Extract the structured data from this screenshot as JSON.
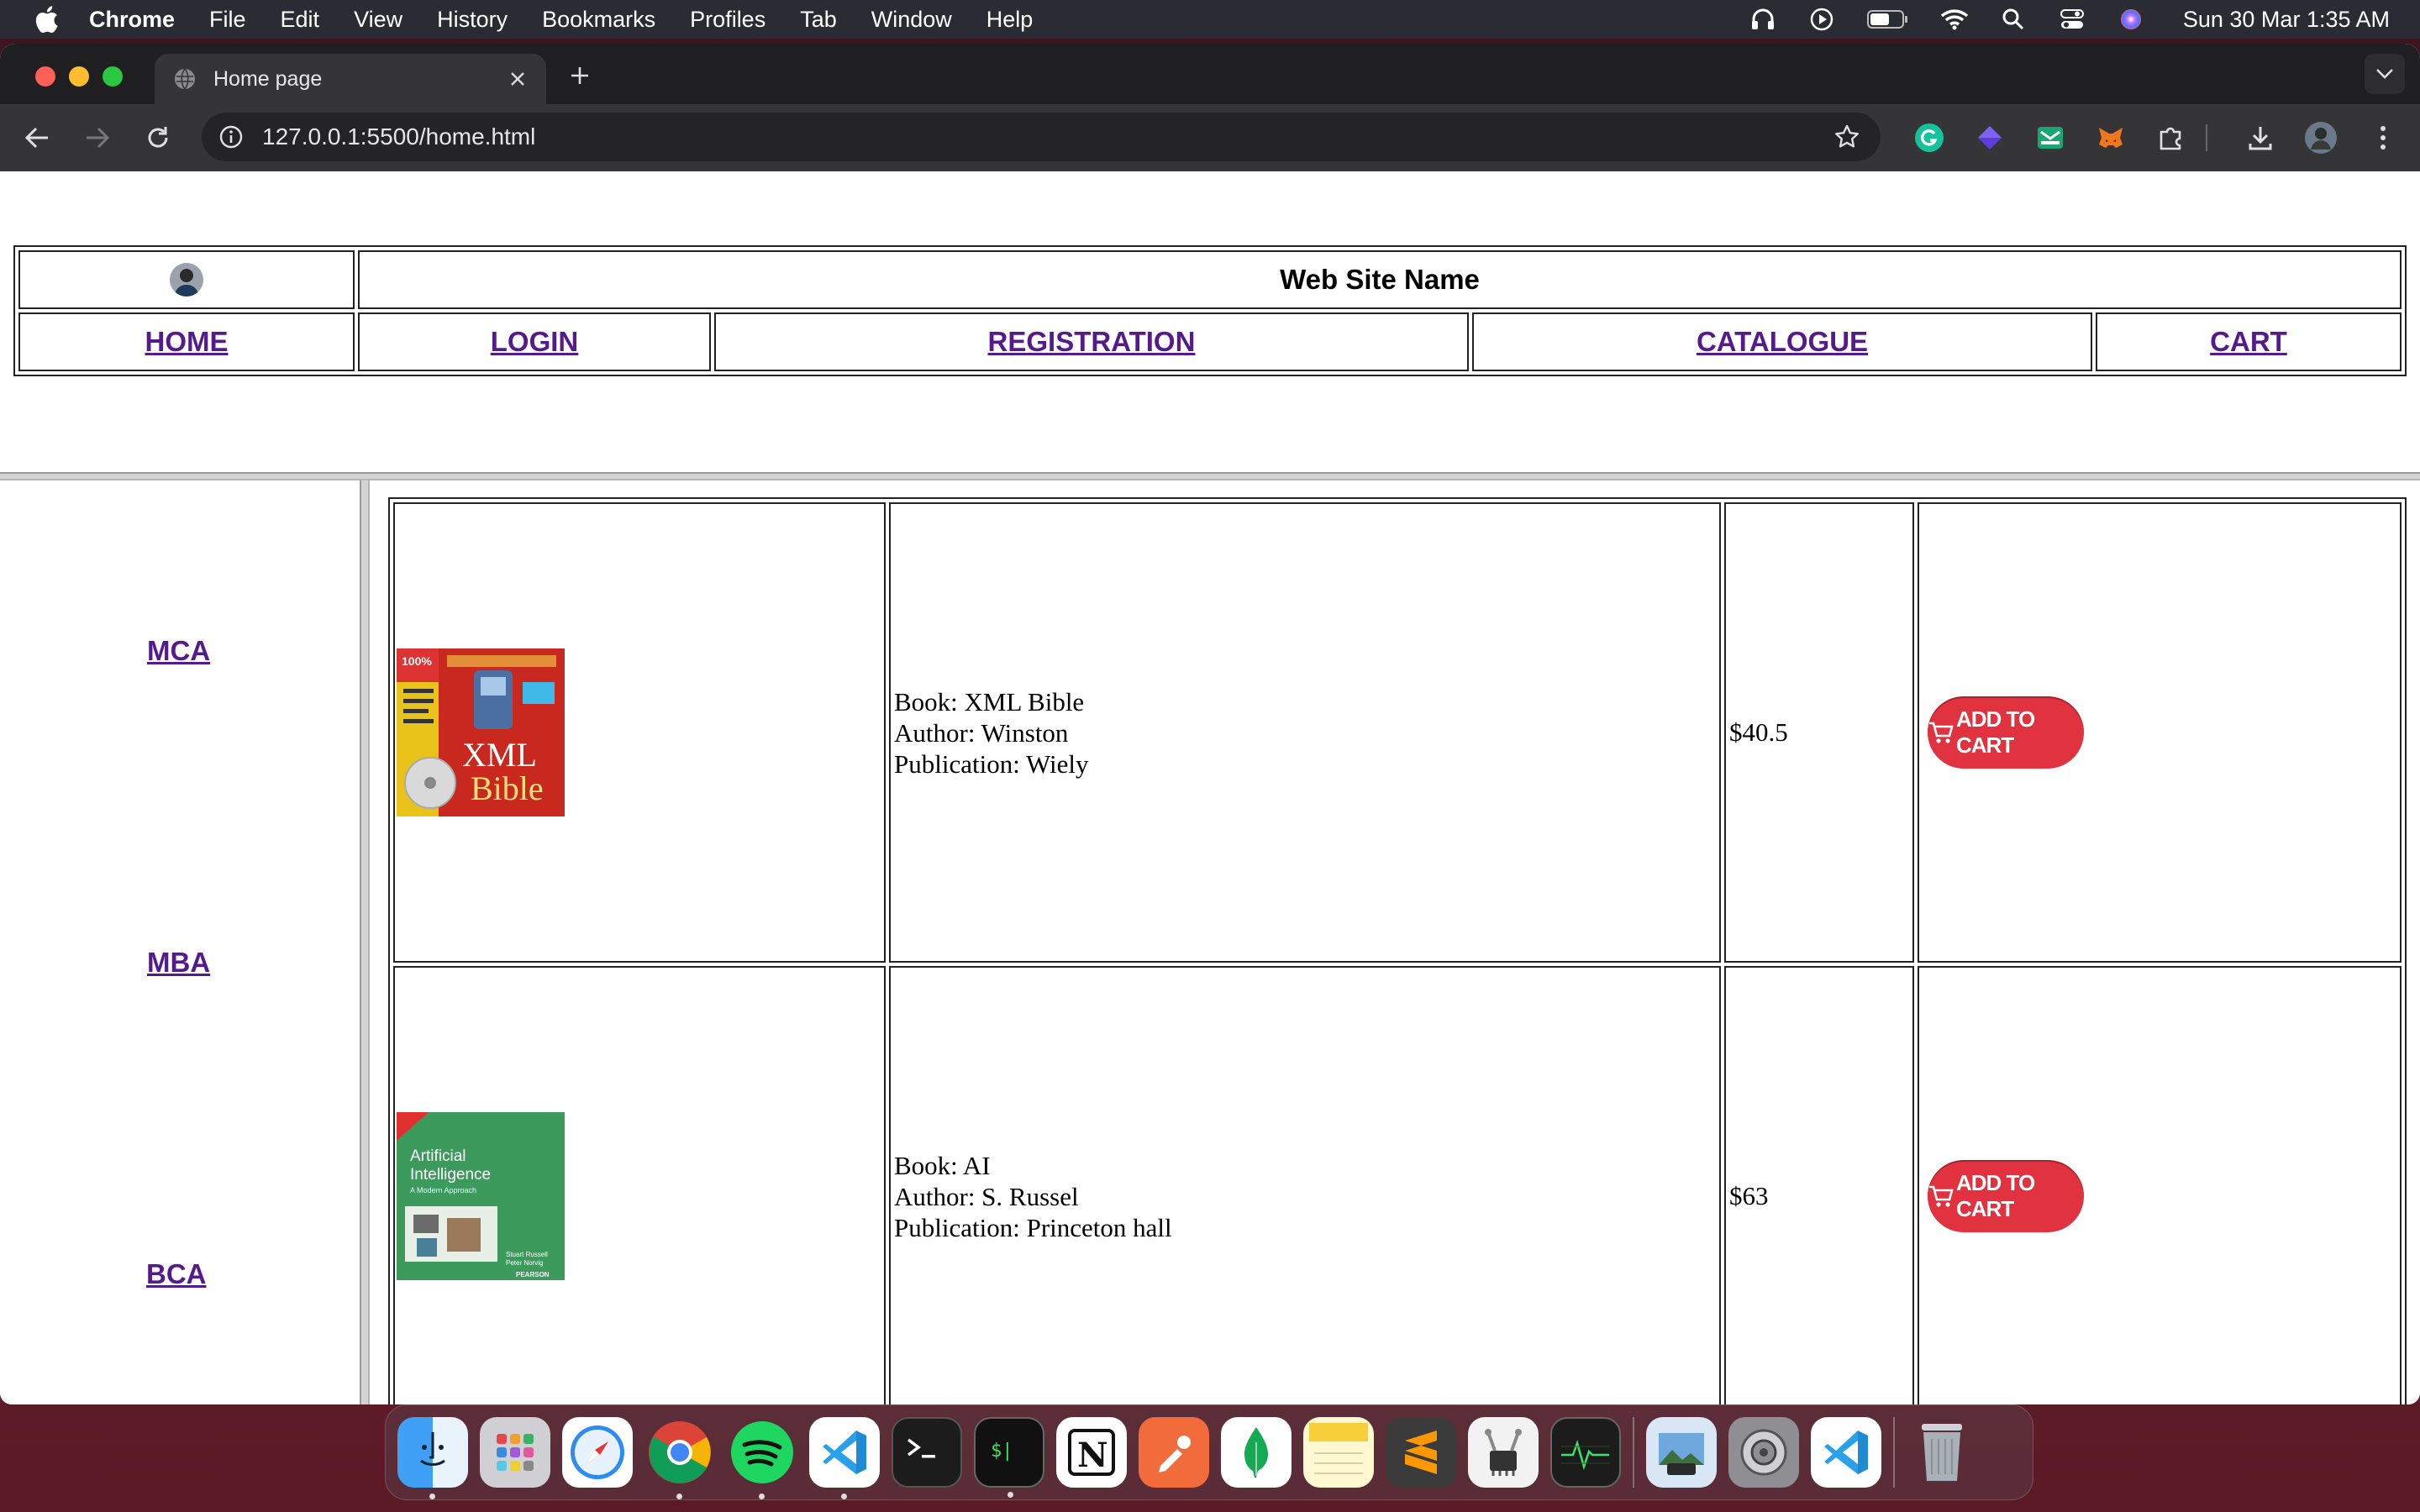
{
  "menubar": {
    "app": "Chrome",
    "items": [
      "File",
      "Edit",
      "View",
      "History",
      "Bookmarks",
      "Profiles",
      "Tab",
      "Window",
      "Help"
    ],
    "clock": "Sun 30 Mar  1:35 AM"
  },
  "browser": {
    "tab_title": "Home page",
    "url": "127.0.0.1:5500/home.html"
  },
  "site": {
    "name": "Web Site Name",
    "nav": [
      "HOME",
      "LOGIN",
      "REGISTRATION",
      "CATALOGUE",
      "CART"
    ]
  },
  "sidebar": {
    "links": [
      "MCA",
      "MBA",
      "BCA"
    ]
  },
  "books": [
    {
      "book": "Book: XML Bible",
      "author": "Author: Winston",
      "publication": "Publication: Wiely",
      "price": "$40.5",
      "cover_text": "XML Bible",
      "button": "ADD TO CART"
    },
    {
      "book": "Book: AI",
      "author": "Author: S. Russel",
      "publication": "Publication: Princeton hall",
      "price": "$63",
      "cover_text": "Artificial Intelligence",
      "button": "ADD TO CART"
    }
  ],
  "colors": {
    "link": "#551a8b",
    "cart_button": "#e0323f"
  },
  "dock": {
    "apps": [
      "finder-icon",
      "launchpad-icon",
      "safari-icon",
      "chrome-icon",
      "spotify-icon",
      "vscode-icon",
      "terminal-icon",
      "iterm-icon",
      "notion-icon",
      "postman-icon",
      "mongodb-icon",
      "notes-icon",
      "sublime-icon",
      "system-info-icon",
      "activity-monitor-icon",
      "preview-icon",
      "system-settings-icon",
      "vscode-icon",
      "trash-icon"
    ]
  }
}
